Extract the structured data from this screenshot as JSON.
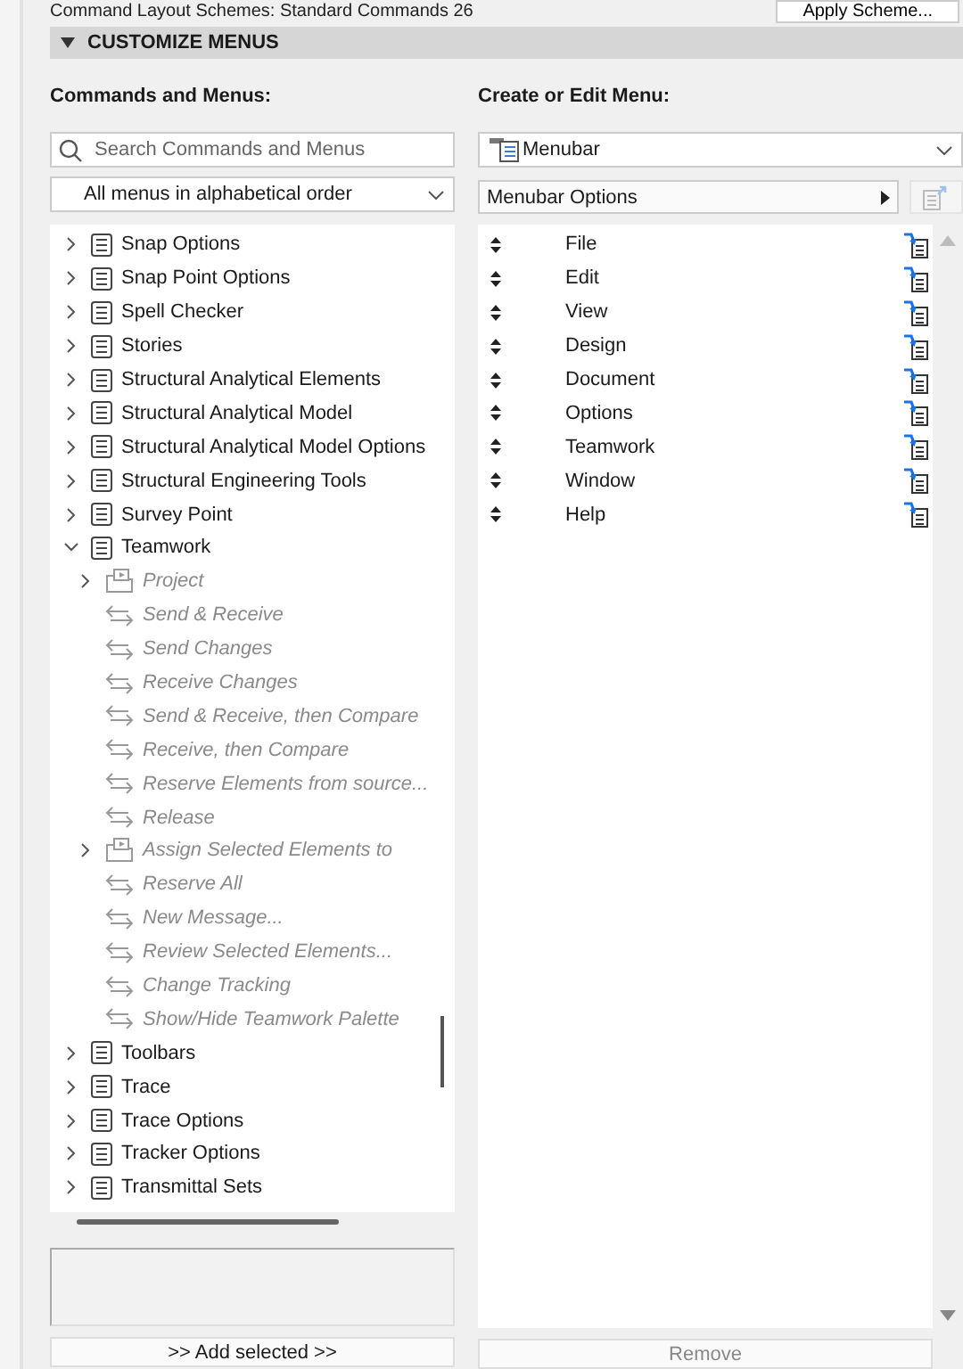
{
  "top_bar": {
    "scheme_label": "Command Layout Schemes: Standard Commands 26",
    "apply_button": "Apply Scheme..."
  },
  "section": {
    "title": "CUSTOMIZE MENUS",
    "expanded": true
  },
  "left": {
    "heading": "Commands and Menus:",
    "search": {
      "placeholder": "Search Commands and Menus"
    },
    "filter": {
      "value": "All menus in alphabetical order"
    },
    "tree": [
      {
        "kind": "menu",
        "label": "Snap Options",
        "expanded": false,
        "disabled": false
      },
      {
        "kind": "menu",
        "label": "Snap Point Options",
        "expanded": false,
        "disabled": false
      },
      {
        "kind": "menu",
        "label": "Spell Checker",
        "expanded": false,
        "disabled": false
      },
      {
        "kind": "menu",
        "label": "Stories",
        "expanded": false,
        "disabled": false
      },
      {
        "kind": "menu",
        "label": "Structural Analytical Elements",
        "expanded": false,
        "disabled": false
      },
      {
        "kind": "menu",
        "label": "Structural Analytical Model",
        "expanded": false,
        "disabled": false
      },
      {
        "kind": "menu",
        "label": "Structural Analytical Model Options",
        "expanded": false,
        "disabled": false
      },
      {
        "kind": "menu",
        "label": "Structural Engineering Tools",
        "expanded": false,
        "disabled": false
      },
      {
        "kind": "menu",
        "label": "Survey Point",
        "expanded": false,
        "disabled": false
      },
      {
        "kind": "menu",
        "label": "Teamwork",
        "expanded": true,
        "disabled": false,
        "children": [
          {
            "kind": "submenu",
            "label": "Project",
            "expanded": false,
            "disabled": true
          },
          {
            "kind": "command",
            "label": "Send & Receive",
            "disabled": true
          },
          {
            "kind": "command",
            "label": "Send Changes",
            "disabled": true
          },
          {
            "kind": "command",
            "label": "Receive Changes",
            "disabled": true
          },
          {
            "kind": "command",
            "label": "Send & Receive, then Compare",
            "disabled": true
          },
          {
            "kind": "command",
            "label": "Receive, then Compare",
            "disabled": true
          },
          {
            "kind": "command",
            "label": "Reserve Elements from source...",
            "disabled": true
          },
          {
            "kind": "command",
            "label": "Release",
            "disabled": true
          },
          {
            "kind": "submenu",
            "label": "Assign Selected Elements to",
            "expanded": false,
            "disabled": true
          },
          {
            "kind": "command",
            "label": "Reserve All",
            "disabled": true
          },
          {
            "kind": "command",
            "label": "New Message...",
            "disabled": true
          },
          {
            "kind": "command",
            "label": "Review Selected Elements...",
            "disabled": true
          },
          {
            "kind": "command",
            "label": "Change Tracking",
            "disabled": true
          },
          {
            "kind": "command",
            "label": "Show/Hide Teamwork Palette",
            "disabled": true
          }
        ]
      },
      {
        "kind": "menu",
        "label": "Toolbars",
        "expanded": false,
        "disabled": false
      },
      {
        "kind": "menu",
        "label": "Trace",
        "expanded": false,
        "disabled": false
      },
      {
        "kind": "menu",
        "label": "Trace Options",
        "expanded": false,
        "disabled": false
      },
      {
        "kind": "menu",
        "label": "Tracker Options",
        "expanded": false,
        "disabled": false
      },
      {
        "kind": "menu",
        "label": "Transmittal Sets",
        "expanded": false,
        "disabled": false
      }
    ],
    "add_button": {
      "label": ">> Add selected >>",
      "disabled": false
    }
  },
  "right": {
    "heading": "Create or Edit Menu:",
    "menu_select": {
      "value": "Menubar"
    },
    "options_button": "Menubar Options",
    "items": [
      {
        "label": "File"
      },
      {
        "label": "Edit"
      },
      {
        "label": "View"
      },
      {
        "label": "Design"
      },
      {
        "label": "Document"
      },
      {
        "label": "Options"
      },
      {
        "label": "Teamwork"
      },
      {
        "label": "Window"
      },
      {
        "label": "Help"
      }
    ],
    "remove_button": {
      "label": "Remove",
      "disabled": true
    }
  }
}
